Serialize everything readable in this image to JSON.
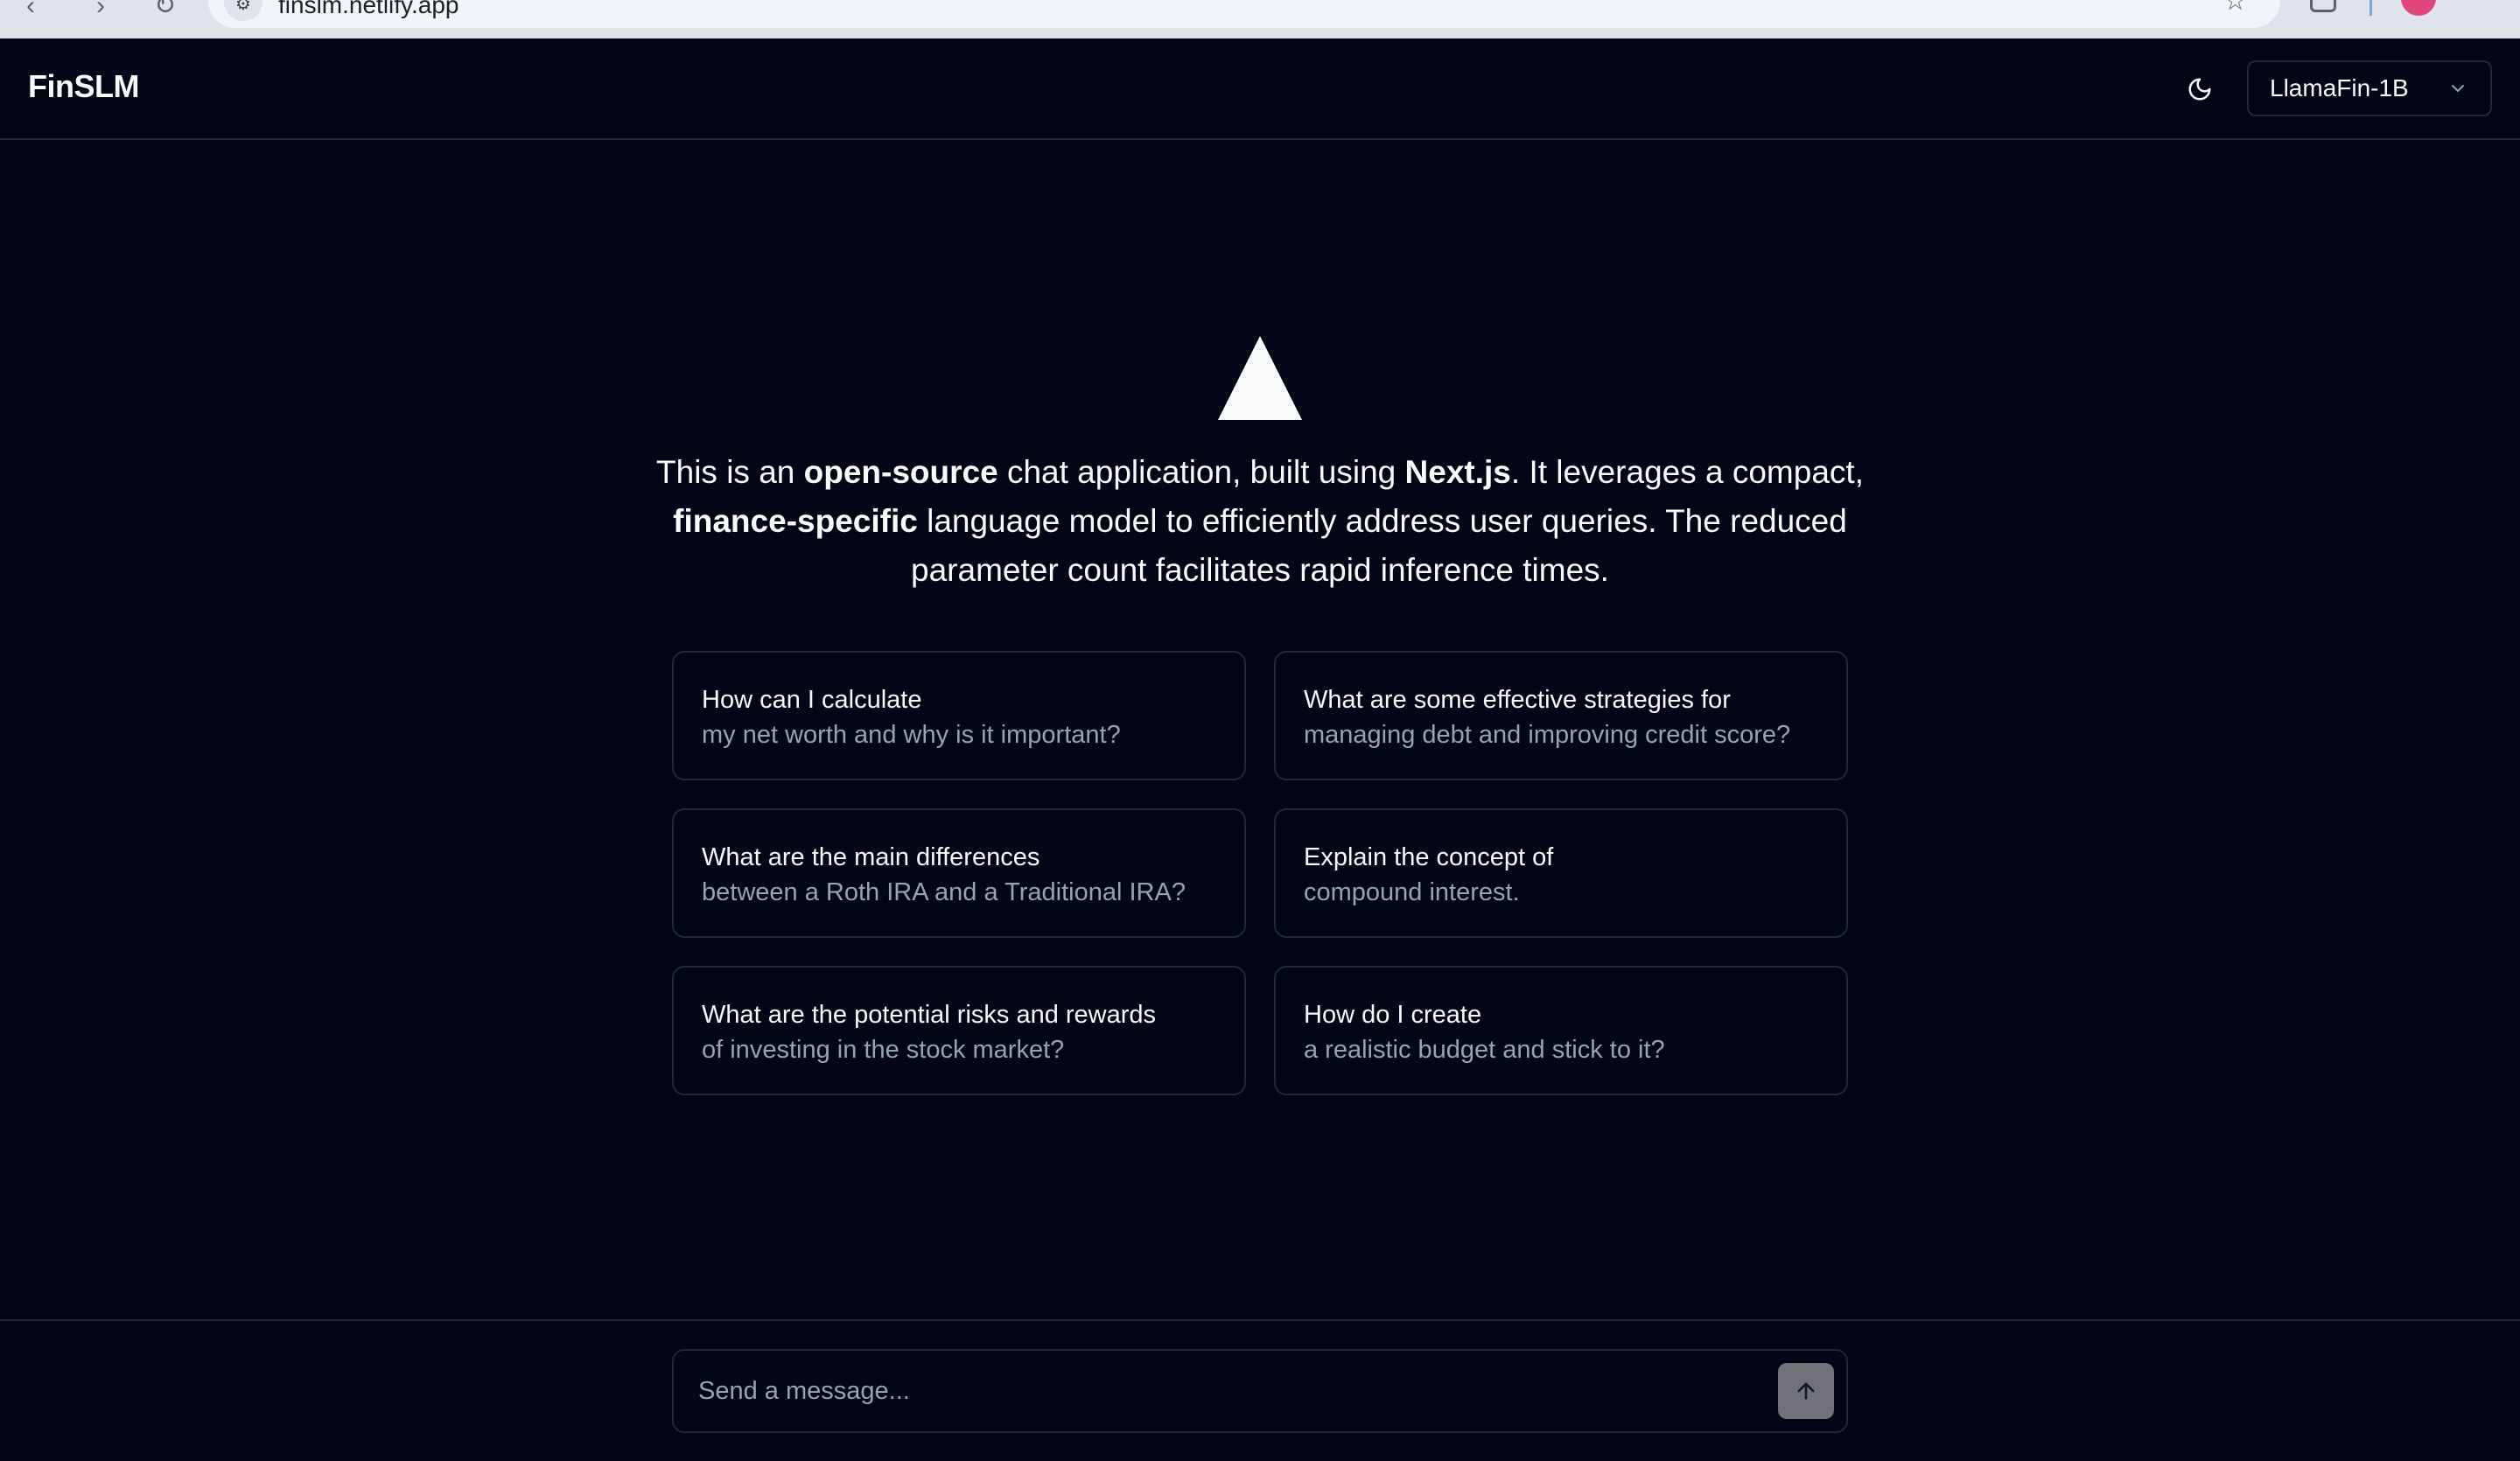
{
  "browser": {
    "url": "finslm.netlify.app"
  },
  "header": {
    "brand": "FinSLM",
    "model_selected": "LlamaFin-1B"
  },
  "intro": {
    "parts": [
      "This is an ",
      "open-source",
      " chat application, built using ",
      "Next.js",
      ". It leverages a compact, ",
      "finance-specific",
      " language model to efficiently address user queries. The reduced parameter count facilitates rapid inference times."
    ]
  },
  "suggestions": [
    {
      "title": "How can I calculate",
      "subtitle": "my net worth and why is it important?"
    },
    {
      "title": "What are some effective strategies for",
      "subtitle": "managing debt and improving credit score?"
    },
    {
      "title": "What are the main differences",
      "subtitle": "between a Roth IRA and a Traditional IRA?"
    },
    {
      "title": "Explain the concept of",
      "subtitle": "compound interest."
    },
    {
      "title": "What are the potential risks and rewards",
      "subtitle": "of investing in the stock market?"
    },
    {
      "title": "How do I create",
      "subtitle": "a realistic budget and stick to it?"
    }
  ],
  "composer": {
    "placeholder": "Send a message..."
  },
  "icons": {
    "theme_toggle": "moon-icon",
    "model_dropdown": "chevron-down-icon",
    "send": "arrow-up-icon",
    "logo": "triangle-logo-icon"
  },
  "colors": {
    "background": "#020617",
    "border": "#1e293b",
    "text_primary": "#f8fafc",
    "text_muted": "#94a3b8",
    "send_button": "#71717a"
  }
}
